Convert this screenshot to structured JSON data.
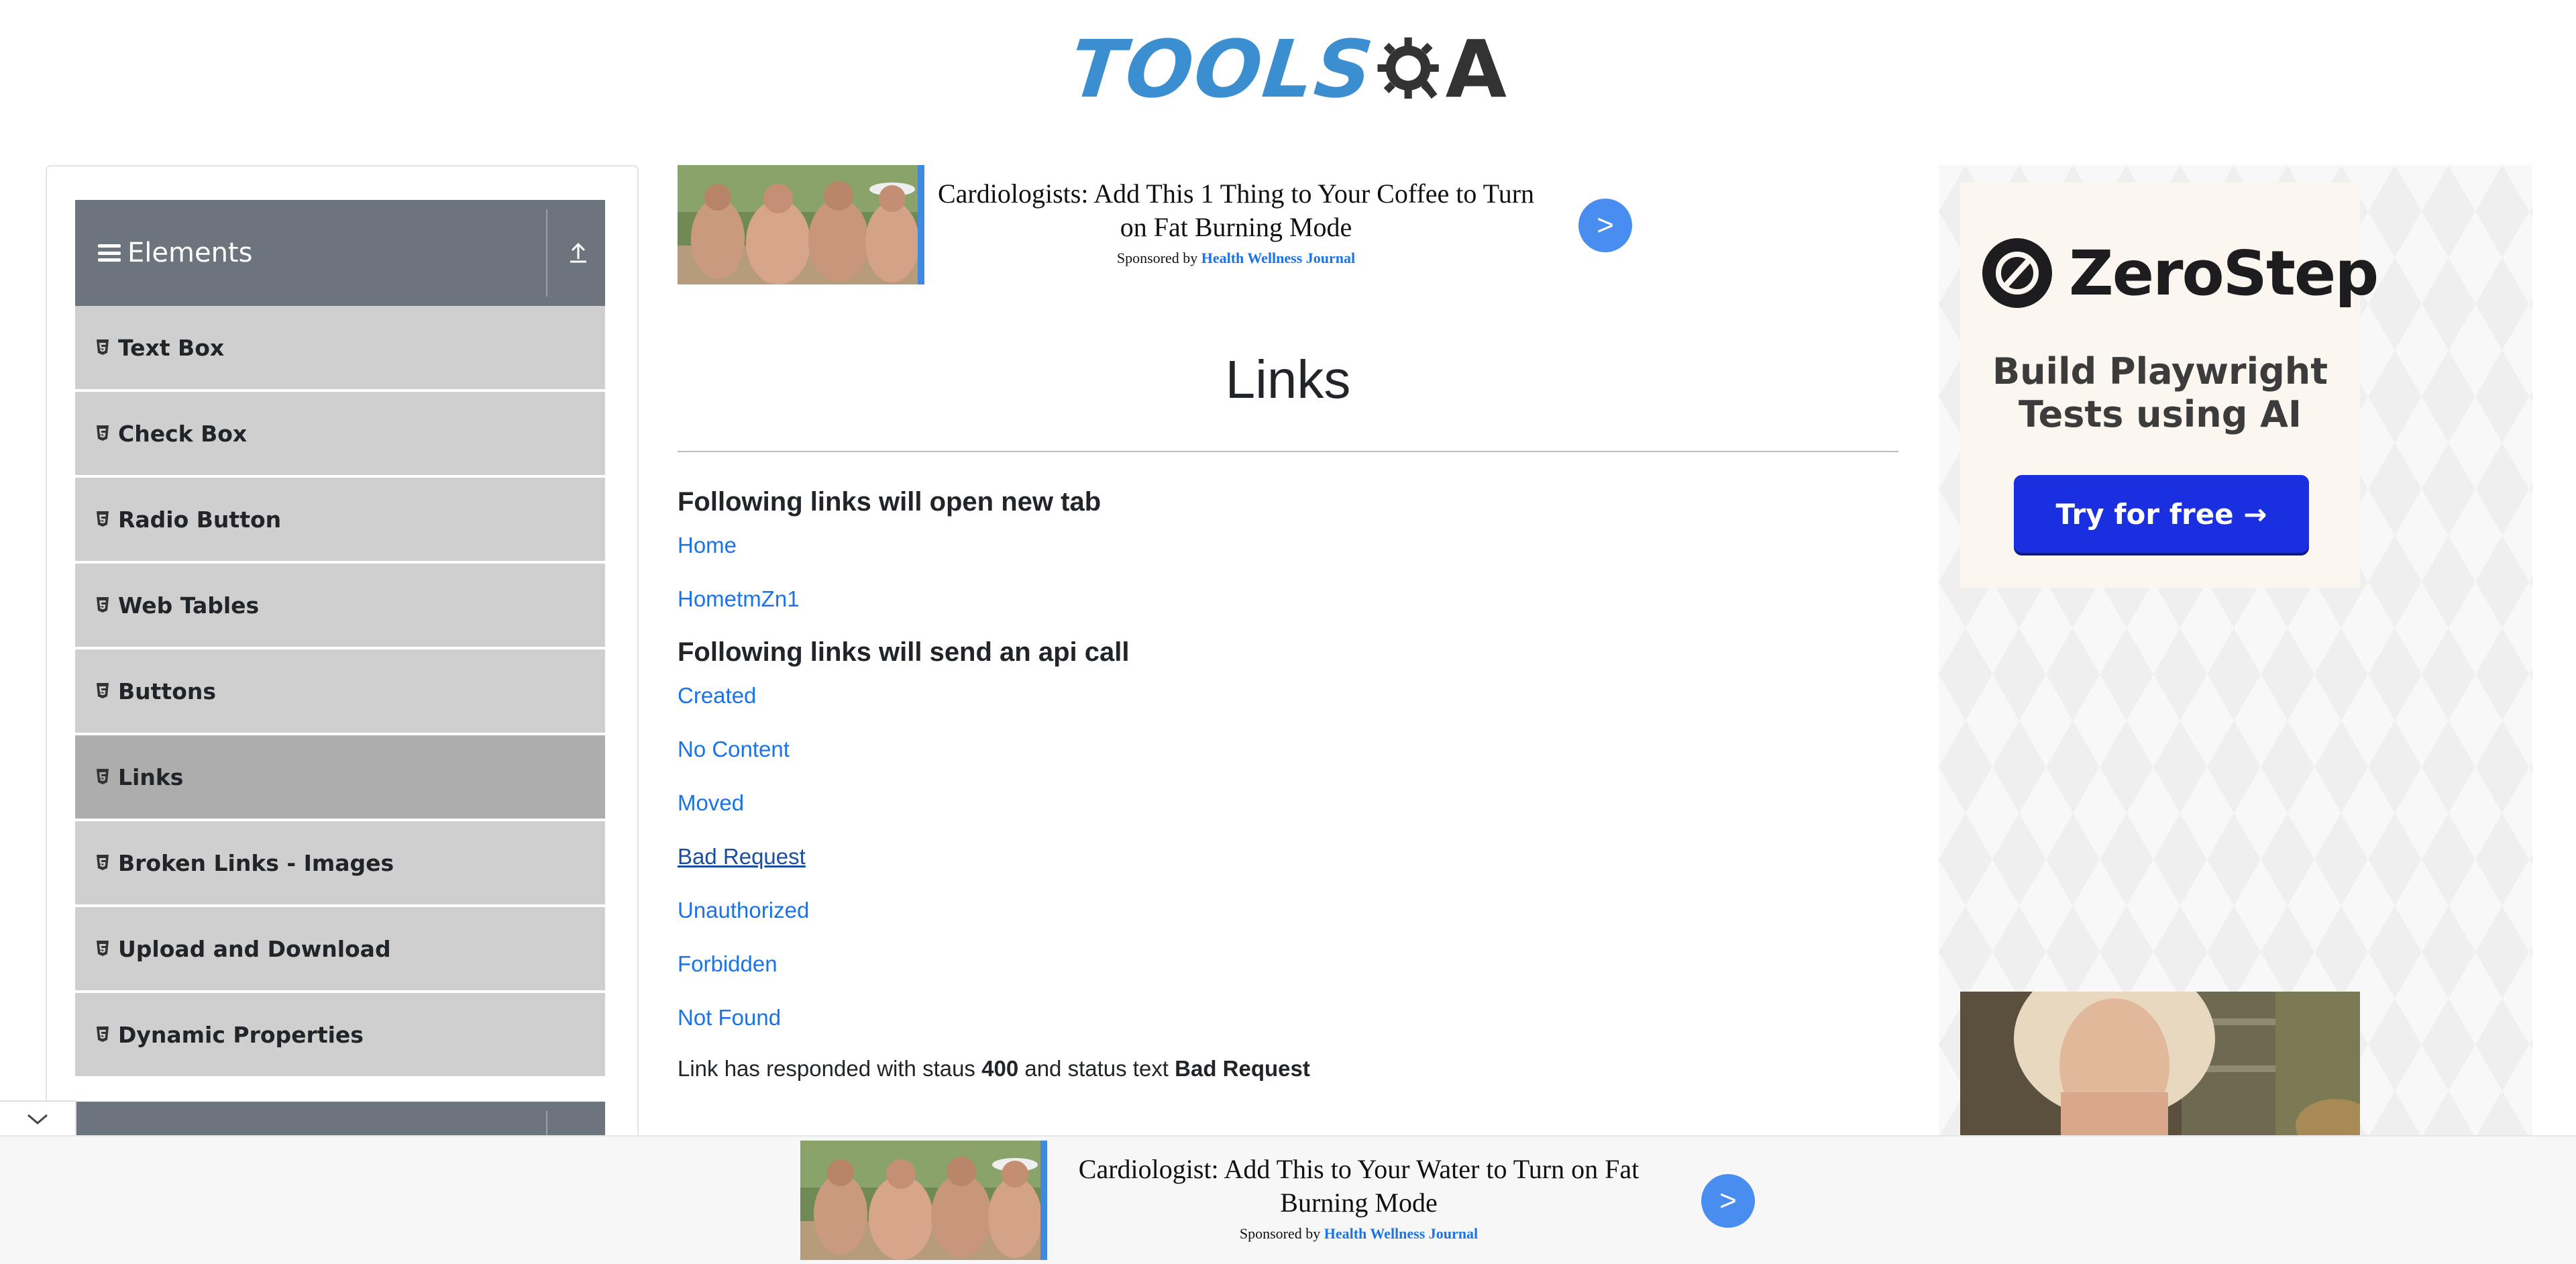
{
  "logo": {
    "text_left": "TOOLS",
    "text_right": "A"
  },
  "sidebar": {
    "group_title": "Elements",
    "items": [
      {
        "label": "Text Box"
      },
      {
        "label": "Check Box"
      },
      {
        "label": "Radio Button"
      },
      {
        "label": "Web Tables"
      },
      {
        "label": "Buttons"
      },
      {
        "label": "Links",
        "active": true
      },
      {
        "label": "Broken Links - Images"
      },
      {
        "label": "Upload and Download"
      },
      {
        "label": "Dynamic Properties"
      }
    ]
  },
  "ad_top": {
    "headline": "Cardiologists: Add This 1 Thing to Your Coffee to Turn on Fat Burning Mode",
    "sponsored_prefix": "Sponsored by",
    "brand": "Health Wellness Journal",
    "arrow": ">"
  },
  "main": {
    "title": "Links",
    "section1_heading": "Following links will open new tab",
    "new_tab_links": [
      "Home",
      "HometmZn1"
    ],
    "section2_heading": "Following links will send an api call",
    "api_links": [
      "Created",
      "No Content",
      "Moved",
      "Bad Request",
      "Unauthorized",
      "Forbidden",
      "Not Found"
    ],
    "response": {
      "prefix": "Link has responded with staus",
      "status": "400",
      "middle": "and status text",
      "status_text": "Bad Request"
    }
  },
  "right_ad": {
    "brand": "ZeroStep",
    "tagline_line1": "Build Playwright",
    "tagline_line2": "Tests using AI",
    "cta": "Try for free →"
  },
  "ad_bottom": {
    "headline": "Cardiologist: Add This to Your Water to Turn on Fat Burning Mode",
    "sponsored_prefix": "Sponsored by",
    "brand": "Health Wellness Journal",
    "arrow": ">"
  },
  "colors": {
    "link": "#1a73e8",
    "sidebar_header": "#6c757d",
    "sidebar_item": "#cfcfcf",
    "sidebar_item_active": "#adadad",
    "logo_blue": "#3b8fd0",
    "cta_blue": "#1a2fe0"
  }
}
